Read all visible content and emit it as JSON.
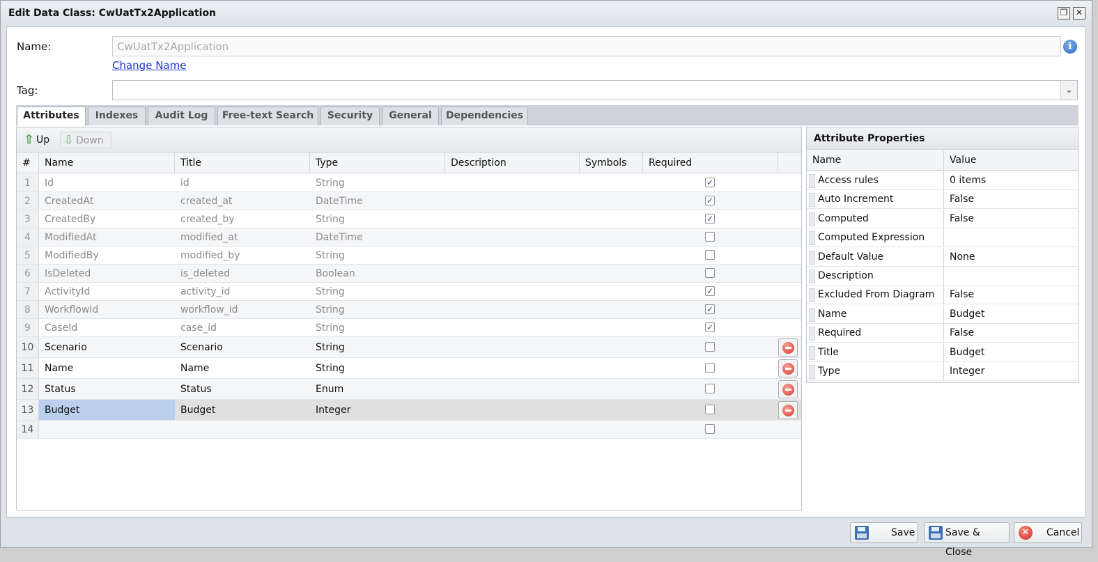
{
  "window": {
    "title": "Edit Data Class: CwUatTx2Application",
    "maximize_glyph": "❐",
    "close_glyph": "✕"
  },
  "form": {
    "name_label": "Name:",
    "name_value": "CwUatTx2Application",
    "change_name_link": "Change Name",
    "tag_label": "Tag:",
    "tag_value": "",
    "info_glyph": "i",
    "dropdown_glyph": "⌄"
  },
  "tabs": [
    "Attributes",
    "Indexes",
    "Audit Log",
    "Free-text Search",
    "Security",
    "General",
    "Dependencies"
  ],
  "active_tab": "Attributes",
  "toolbar": {
    "up_label": "Up",
    "down_label": "Down",
    "up_glyph": "⇧",
    "down_glyph": "⇩"
  },
  "grid": {
    "columns": [
      "#",
      "Name",
      "Title",
      "Type",
      "Description",
      "Symbols",
      "Required"
    ],
    "rows": [
      {
        "num": "1",
        "name": "Id",
        "title": "id",
        "type": "String",
        "required": true,
        "readonly": true
      },
      {
        "num": "2",
        "name": "CreatedAt",
        "title": "created_at",
        "type": "DateTime",
        "required": true,
        "readonly": true
      },
      {
        "num": "3",
        "name": "CreatedBy",
        "title": "created_by",
        "type": "String",
        "required": true,
        "readonly": true
      },
      {
        "num": "4",
        "name": "ModifiedAt",
        "title": "modified_at",
        "type": "DateTime",
        "required": false,
        "readonly": true
      },
      {
        "num": "5",
        "name": "ModifiedBy",
        "title": "modified_by",
        "type": "String",
        "required": false,
        "readonly": true
      },
      {
        "num": "6",
        "name": "IsDeleted",
        "title": "is_deleted",
        "type": "Boolean",
        "required": false,
        "readonly": true
      },
      {
        "num": "7",
        "name": "ActivityId",
        "title": "activity_id",
        "type": "String",
        "required": true,
        "readonly": true
      },
      {
        "num": "8",
        "name": "WorkflowId",
        "title": "workflow_id",
        "type": "String",
        "required": true,
        "readonly": true
      },
      {
        "num": "9",
        "name": "CaseId",
        "title": "case_id",
        "type": "String",
        "required": true,
        "readonly": true
      },
      {
        "num": "10",
        "name": "Scenario",
        "title": "Scenario",
        "type": "String",
        "required": false,
        "readonly": false
      },
      {
        "num": "11",
        "name": "Name",
        "title": "Name",
        "type": "String",
        "required": false,
        "readonly": false
      },
      {
        "num": "12",
        "name": "Status",
        "title": "Status",
        "type": "Enum",
        "required": false,
        "readonly": false
      },
      {
        "num": "13",
        "name": "Budget",
        "title": "Budget",
        "type": "Integer",
        "required": false,
        "readonly": false,
        "selected": true
      },
      {
        "num": "14",
        "name": "",
        "title": "",
        "type": "",
        "required": false,
        "readonly": false,
        "empty": true
      }
    ]
  },
  "properties": {
    "title": "Attribute Properties",
    "columns": [
      "Name",
      "Value"
    ],
    "rows": [
      {
        "name": "Access rules",
        "value": "0 items"
      },
      {
        "name": "Auto Increment",
        "value": "False"
      },
      {
        "name": "Computed",
        "value": "False"
      },
      {
        "name": "Computed Expression",
        "value": ""
      },
      {
        "name": "Default Value",
        "value": "None"
      },
      {
        "name": "Description",
        "value": ""
      },
      {
        "name": "Excluded From Diagram",
        "value": "False"
      },
      {
        "name": "Name",
        "value": "Budget"
      },
      {
        "name": "Required",
        "value": "False"
      },
      {
        "name": "Title",
        "value": "Budget"
      },
      {
        "name": "Type",
        "value": "Integer"
      }
    ]
  },
  "footer": {
    "save_label": "Save",
    "save_close_label": "Save & Close",
    "cancel_label": "Cancel",
    "cancel_glyph": "✕"
  },
  "colors": {
    "link": "#1a33cc",
    "selected_cell": "#b9cfec",
    "checkmark": "#2b4d9a",
    "delete": "#d9372b"
  }
}
